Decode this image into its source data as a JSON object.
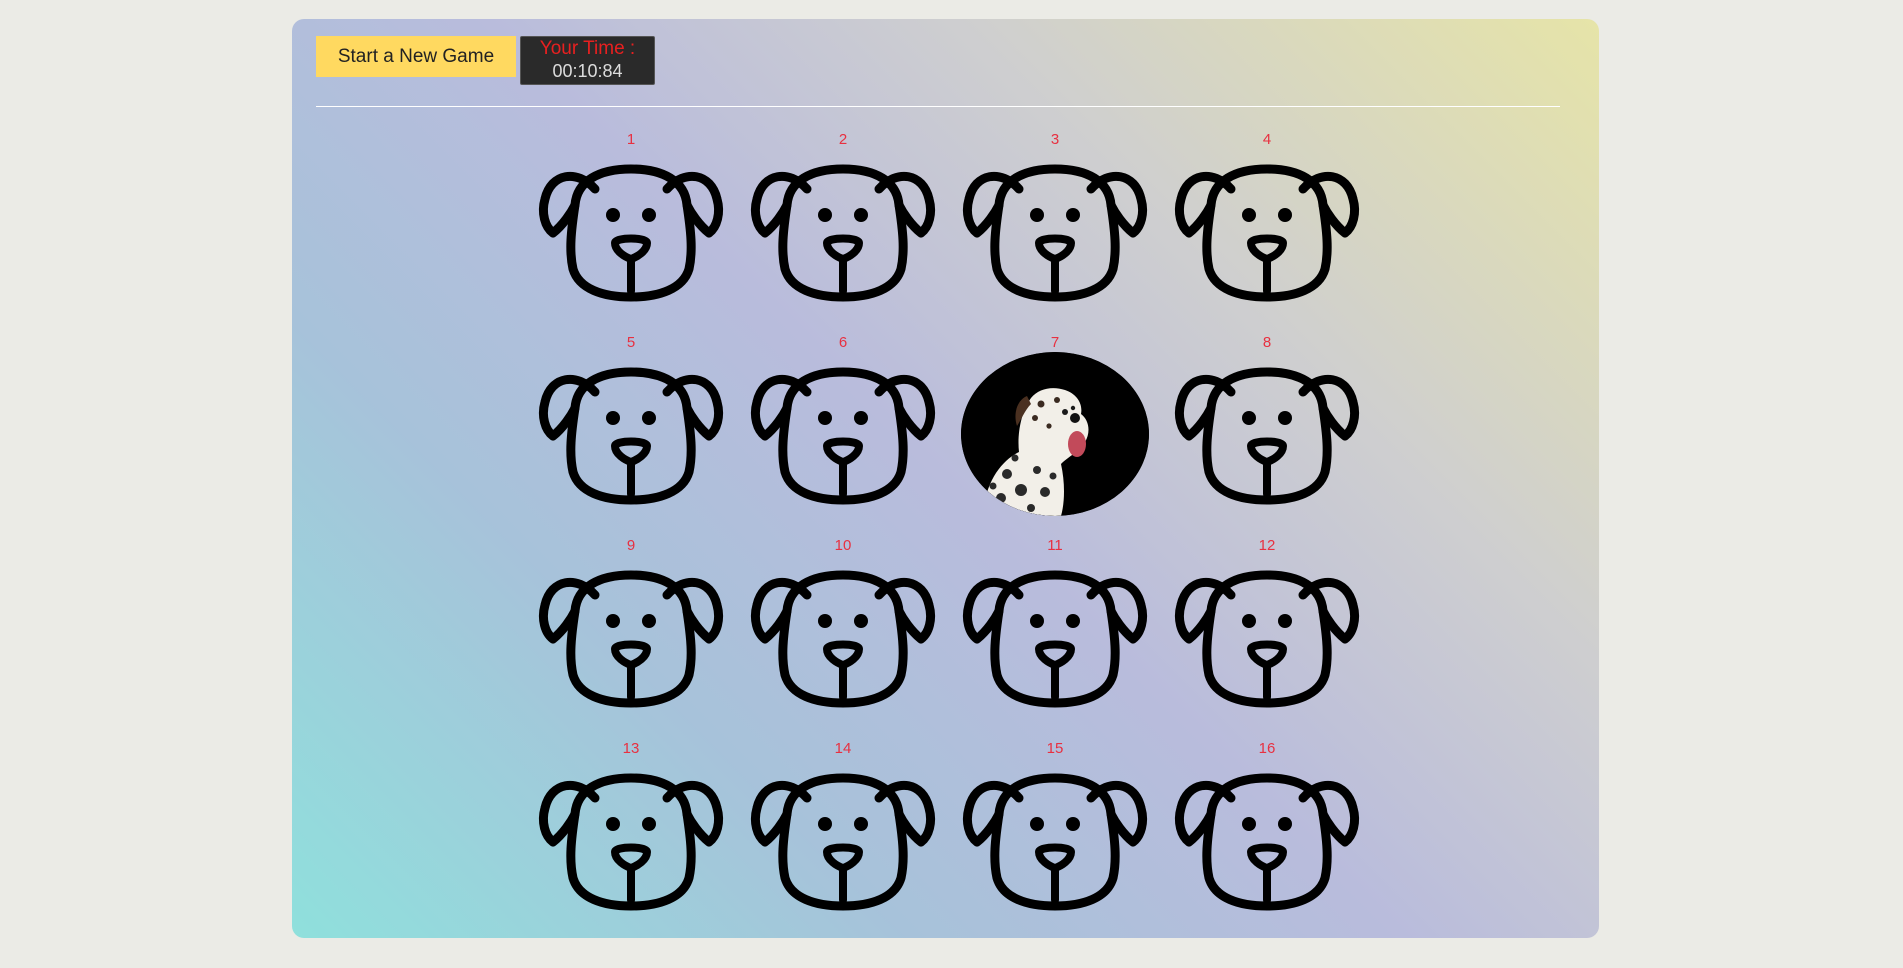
{
  "toolbar": {
    "new_game_label": "Start a New Game",
    "timer_label": "Your Time :",
    "timer_value": "00:10:84"
  },
  "cards": [
    {
      "number": "1",
      "state": "hidden"
    },
    {
      "number": "2",
      "state": "hidden"
    },
    {
      "number": "3",
      "state": "hidden"
    },
    {
      "number": "4",
      "state": "hidden"
    },
    {
      "number": "5",
      "state": "hidden"
    },
    {
      "number": "6",
      "state": "hidden"
    },
    {
      "number": "7",
      "state": "revealed",
      "image": "dalmatian-dog"
    },
    {
      "number": "8",
      "state": "hidden"
    },
    {
      "number": "9",
      "state": "hidden"
    },
    {
      "number": "10",
      "state": "hidden"
    },
    {
      "number": "11",
      "state": "hidden"
    },
    {
      "number": "12",
      "state": "hidden"
    },
    {
      "number": "13",
      "state": "hidden"
    },
    {
      "number": "14",
      "state": "hidden"
    },
    {
      "number": "15",
      "state": "hidden"
    },
    {
      "number": "16",
      "state": "hidden"
    }
  ],
  "colors": {
    "button": "#ffd960",
    "timer_bg": "#2a2a2a",
    "timer_label": "#e82020",
    "card_number": "#e83040"
  },
  "icons": {
    "hidden_card": "dog-face-outline-icon"
  }
}
